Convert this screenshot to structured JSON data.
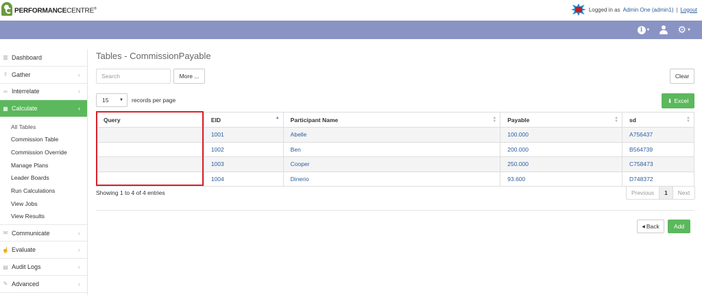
{
  "app": {
    "logo_text_bold": "PERFORMANCE",
    "logo_text_light": "CENTRE",
    "logo_mark": "®"
  },
  "header": {
    "logged_in_prefix": "Logged in as",
    "user_link": "Admin One (admin1)",
    "separator": "|",
    "logout": "Logout"
  },
  "nav_icons": [
    "info-icon",
    "user-icon",
    "gear-icon"
  ],
  "sidebar": {
    "items": [
      {
        "label": "Dashboard",
        "icon": "bar-chart-icon"
      },
      {
        "label": "Gather",
        "icon": "upload-icon"
      },
      {
        "label": "Interrelate",
        "icon": "link-icon"
      },
      {
        "label": "Calculate",
        "icon": "table-icon"
      },
      {
        "label": "Communicate",
        "icon": "comments-icon"
      },
      {
        "label": "Evaluate",
        "icon": "thumbs-up-icon"
      },
      {
        "label": "Audit Logs",
        "icon": "document-icon"
      },
      {
        "label": "Advanced",
        "icon": "wrench-icon"
      }
    ],
    "calculate_sub": [
      "All Tables",
      "Commission Table",
      "Commission Override",
      "Manage Plans",
      "Leader Boards",
      "Run Calculations",
      "View Jobs",
      "View Results"
    ]
  },
  "main": {
    "title": "Tables - CommissionPayable",
    "search_placeholder": "Search",
    "more_label": "More ...",
    "clear_label": "Clear",
    "records_value": "15",
    "records_label": "records per page",
    "excel_label": "Excel",
    "table": {
      "headers": [
        "Query",
        "EID",
        "Participant Name",
        "Payable",
        "sd"
      ],
      "rows": [
        [
          "",
          "1001",
          "Abelle",
          "100.000",
          "A756437"
        ],
        [
          "",
          "1002",
          "Ben",
          "200.000",
          "B564739"
        ],
        [
          "",
          "1003",
          "Cooper",
          "250.000",
          "C758473"
        ],
        [
          "",
          "1004",
          "Dinerio",
          "93.600",
          "D748372"
        ]
      ]
    },
    "showing": "Showing 1 to 4 of 4 entries",
    "pager": {
      "previous": "Previous",
      "current": "1",
      "next": "Next"
    },
    "back_label": "Back",
    "add_label": "Add"
  },
  "colors": {
    "navbar": "#8a94c4",
    "accent_green": "#5cb85c",
    "link": "#2a5d9f",
    "highlight": "#d9202a"
  }
}
